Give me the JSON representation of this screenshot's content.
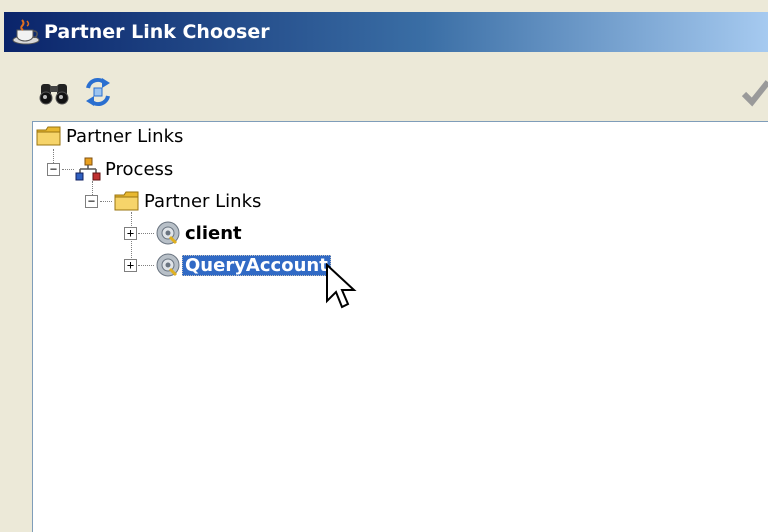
{
  "window": {
    "title": "Partner Link Chooser",
    "title_icon": "coffee-cup-icon"
  },
  "toolbar": {
    "buttons": [
      {
        "icon": "binoculars-icon"
      },
      {
        "icon": "refresh-icon"
      },
      {
        "icon": "check-icon"
      }
    ]
  },
  "tree": {
    "root": {
      "label": "Partner Links",
      "icon": "folder-icon"
    },
    "process": {
      "label": "Process",
      "icon": "process-icon",
      "expanded": true
    },
    "partner_links": {
      "label": "Partner Links",
      "icon": "folder-icon",
      "expanded": true
    },
    "items": [
      {
        "label": "client",
        "icon": "service-gear-icon",
        "selected": false
      },
      {
        "label": "QueryAccount",
        "icon": "service-gear-icon",
        "selected": true
      }
    ]
  },
  "colors": {
    "selection": "#316ac5",
    "titlebar_start": "#0a246a",
    "titlebar_end": "#a6caf0"
  }
}
